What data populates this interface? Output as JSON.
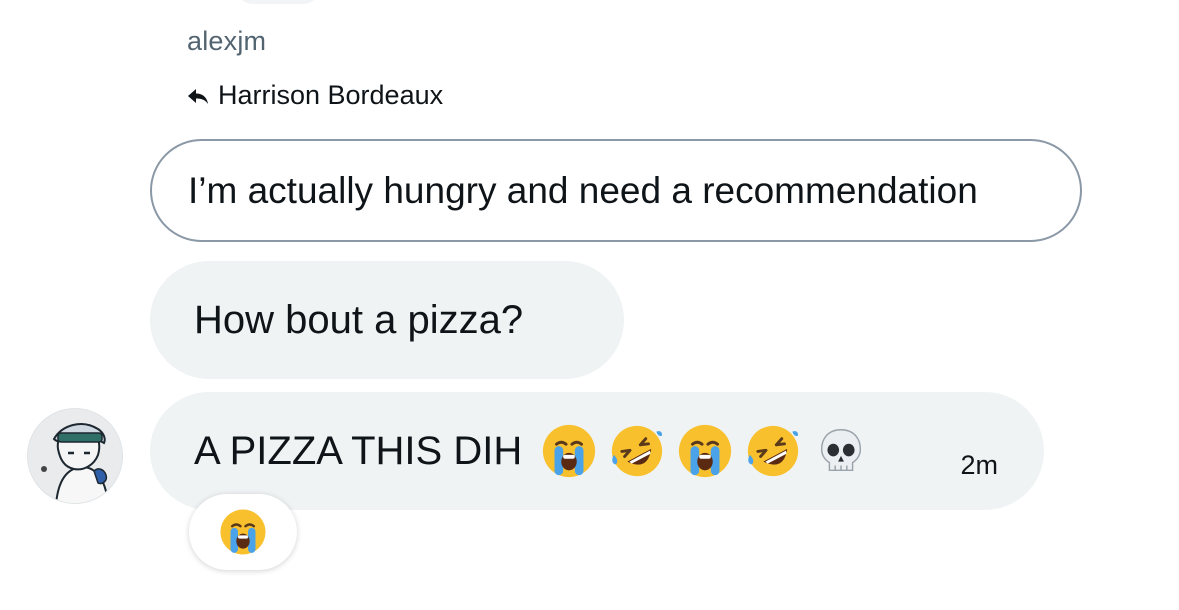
{
  "conversation": {
    "sender_name": "alexjm",
    "reply_to_name": "Harrison Bordeaux",
    "quoted_message": "I’m actually hungry and need a recommendation",
    "messages": [
      {
        "text": "How bout a pizza?"
      },
      {
        "text": "A PIZZA THIS DIH",
        "timestamp": "2m",
        "emojis": [
          "loudly-crying-face",
          "rolling-on-floor-laughing",
          "loudly-crying-face",
          "rolling-on-floor-laughing",
          "skull"
        ]
      }
    ],
    "reaction": "loudly-crying-face"
  },
  "colors": {
    "bubble_bg": "#eff3f4",
    "secondary_text": "#536471",
    "quoted_border": "#8b98a5",
    "emoji_yellow": "#f9c02e",
    "tear_blue": "#4aa3e8"
  }
}
